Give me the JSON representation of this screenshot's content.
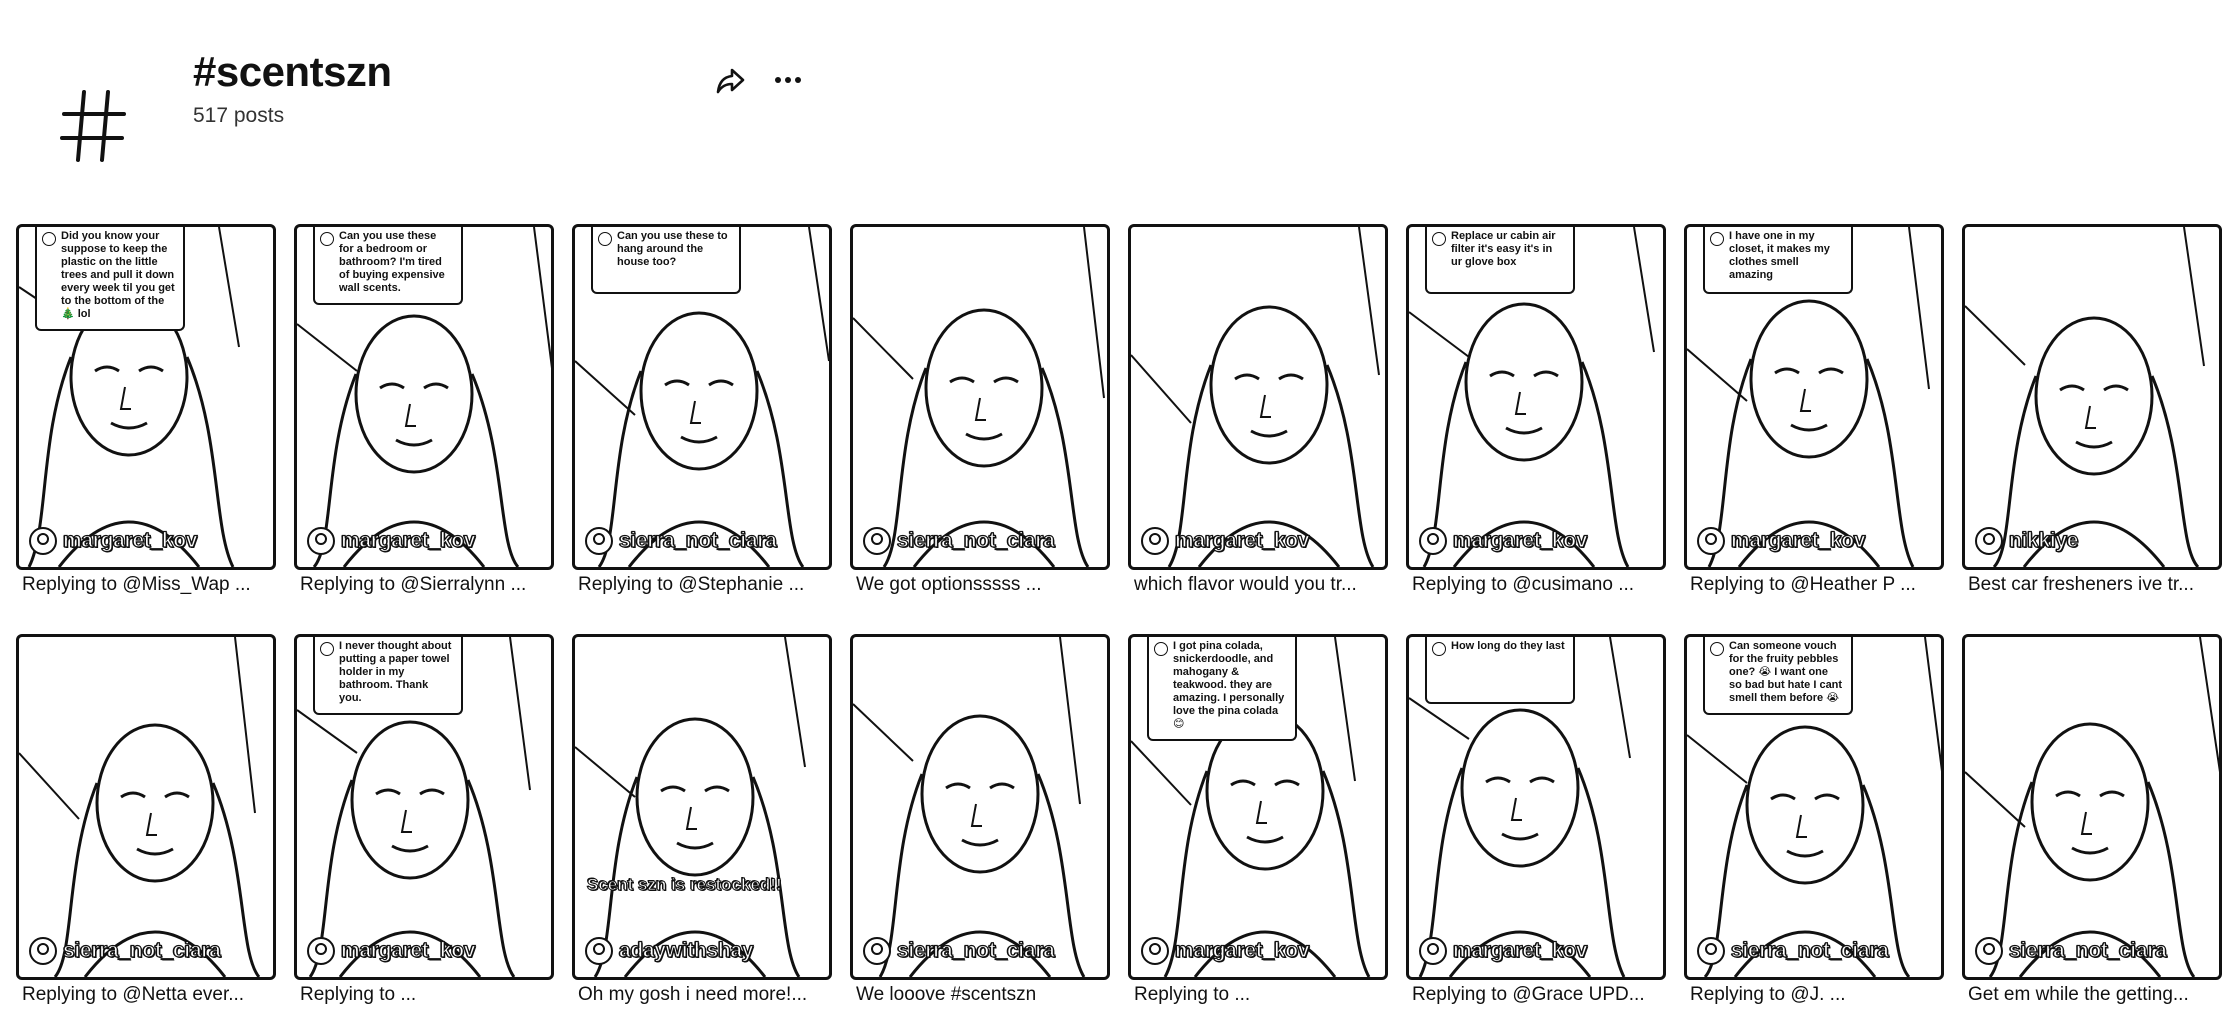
{
  "header": {
    "hashtag": "#scentszn",
    "post_count": "517 posts",
    "hash_icon": "hashtag-icon",
    "share_icon": "share-icon",
    "more_icon": "more-horizontal-icon"
  },
  "posts": [
    {
      "author": "margaret_kov",
      "caption": "Replying to @Miss_Wap ...",
      "bubble": "Did you know your suppose to keep the plastic on the little trees and pull it down every week til you get to the bottom of the 🎄 lol",
      "overlay": ""
    },
    {
      "author": "margaret_kov",
      "caption": "Replying to @Sierralynn ...",
      "bubble": "Can you use these for a bedroom or bathroom? I'm tired of buying expensive wall scents.",
      "overlay": ""
    },
    {
      "author": "sierra_not_ciara",
      "caption": "Replying to @Stephanie ...",
      "bubble": "Can you use these to hang around the house too?",
      "overlay": ""
    },
    {
      "author": "sierra_not_ciara",
      "caption": "We got optionsssss ...",
      "bubble": "",
      "overlay": ""
    },
    {
      "author": "margaret_kov",
      "caption": "which flavor would you tr...",
      "bubble": "",
      "overlay": ""
    },
    {
      "author": "margaret_kov",
      "caption": "Replying to @cusimano ...",
      "bubble": "Replace ur cabin air filter it's easy it's in ur glove box",
      "overlay": ""
    },
    {
      "author": "margaret_kov",
      "caption": "Replying to @Heather P ...",
      "bubble": "I have one in my closet, it makes my clothes smell amazing",
      "overlay": ""
    },
    {
      "author": "nikkiye",
      "caption": "Best car fresheners ive tr...",
      "bubble": "",
      "overlay": ""
    },
    {
      "author": "sierra_not_ciara",
      "caption": "Replying to @Netta ever...",
      "bubble": "",
      "overlay": ""
    },
    {
      "author": "margaret_kov",
      "caption": "Replying to ...",
      "bubble": "I never thought about putting a paper towel holder in my bathroom. Thank you.",
      "overlay": ""
    },
    {
      "author": "adaywithshay",
      "caption": "Oh my gosh i need more!...",
      "bubble": "",
      "overlay": "Scent szn is restocked!!"
    },
    {
      "author": "sierra_not_ciara",
      "caption": "We looove #scentszn",
      "bubble": "",
      "overlay": ""
    },
    {
      "author": "margaret_kov",
      "caption": "Replying to ...",
      "bubble": "I got pina colada, snickerdoodle, and mahogany & teakwood. they are amazing. I personally love the pina colada 😊",
      "overlay": ""
    },
    {
      "author": "margaret_kov",
      "caption": "Replying to @Grace UPD...",
      "bubble": "How long do they last",
      "overlay": ""
    },
    {
      "author": "sierra_not_ciara",
      "caption": "Replying to @J. ...",
      "bubble": "Can someone vouch for the fruity pebbles one? 😭 I want one so bad but hate I cant smell them before 😭",
      "overlay": ""
    },
    {
      "author": "sierra_not_ciara",
      "caption": "Get em while the getting...",
      "bubble": "",
      "overlay": ""
    }
  ]
}
